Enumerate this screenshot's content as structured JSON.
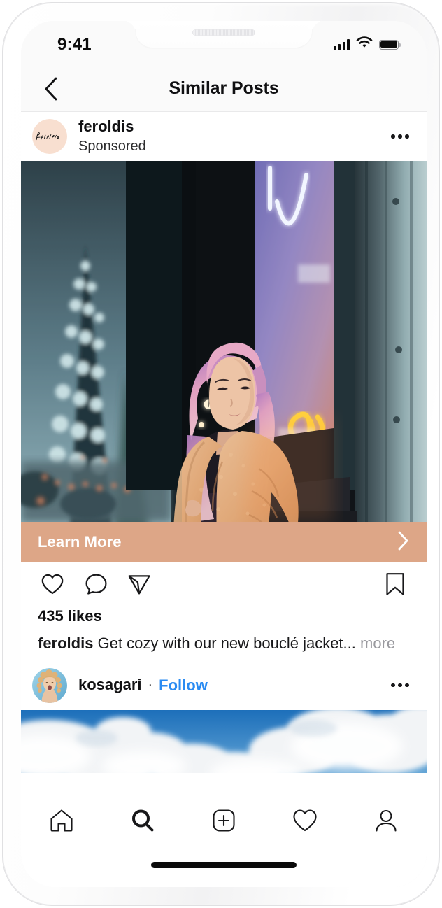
{
  "status_bar": {
    "time": "9:41",
    "signal_icon": "cellular-bars-icon",
    "wifi_icon": "wifi-icon",
    "battery_icon": "battery-full-icon"
  },
  "nav_bar": {
    "back_icon": "chevron-left-icon",
    "title": "Similar Posts"
  },
  "posts": [
    {
      "username": "feroldis",
      "subtitle": "Sponsored",
      "avatar_name": "feroldis-avatar",
      "avatar_logo_text": "Feroldis",
      "avatar_bg": "#f8dfd0",
      "more_icon": "more-options-icon",
      "media_name": "sponsored-post-photo",
      "media_alt": "Woman with pink hair in tan teddy coat sitting outside a neon-lit storefront at night",
      "cta": {
        "label": "Learn More",
        "chevron_icon": "chevron-right-icon",
        "bg_color": "#dda687",
        "text_color": "#ffffff"
      },
      "actions": {
        "like_icon": "heart-icon",
        "comment_icon": "comment-bubble-icon",
        "share_icon": "send-paper-plane-icon",
        "save_icon": "bookmark-icon"
      },
      "likes": "435 likes",
      "caption_user": "feroldis",
      "caption_text": "Get cozy with our new bouclé jacket...",
      "caption_more": "more"
    },
    {
      "username": "kosagari",
      "separator": "·",
      "follow_label": "Follow",
      "follow_color": "#2a8bf2",
      "avatar_name": "kosagari-avatar",
      "avatar_alt": "Portrait of a person with curly blonde hair on a blue background",
      "more_icon": "more-options-icon",
      "media_name": "clouds-photo",
      "media_alt": "Blue sky with white cumulus clouds"
    }
  ],
  "tab_bar": {
    "items": [
      {
        "name": "home-icon",
        "label": "Home",
        "active": false
      },
      {
        "name": "search-icon",
        "label": "Search",
        "active": true
      },
      {
        "name": "add-post-icon",
        "label": "Create",
        "active": false
      },
      {
        "name": "activity-heart-icon",
        "label": "Activity",
        "active": false
      },
      {
        "name": "profile-icon",
        "label": "Profile",
        "active": false
      }
    ]
  },
  "home_indicator": {
    "name": "home-indicator"
  }
}
